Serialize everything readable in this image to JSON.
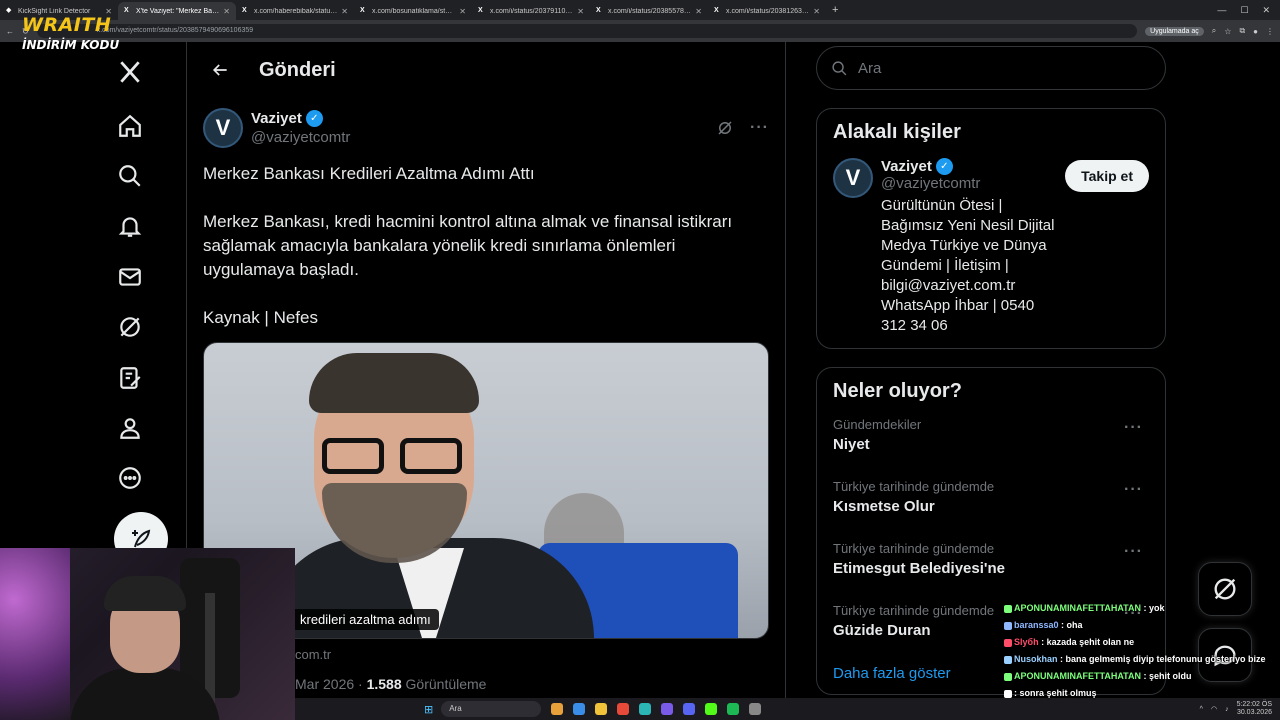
{
  "browser": {
    "tabs": [
      {
        "label": "KickSight Link Detector",
        "active": false
      },
      {
        "label": "X'te Vaziyet: \"Merkez Bankası K",
        "active": true
      },
      {
        "label": "x.com/haberebibak/status/2038",
        "active": false
      },
      {
        "label": "x.com/bosunatiklama/status/20",
        "active": false
      },
      {
        "label": "x.com/i/status/20379110795",
        "active": false
      },
      {
        "label": "x.com/i/status/203855786352",
        "active": false
      },
      {
        "label": "x.com/i/status/20381263057",
        "active": false
      }
    ],
    "url": "x.com/vaziyetcomtr/status/2038579490696106359",
    "app_chip": "Uygulamada aç"
  },
  "overlay_brand": {
    "main": "WRAITH",
    "sub": "İNDİRİM KODU"
  },
  "header": {
    "title": "Gönderi"
  },
  "post": {
    "author_name": "Vaziyet",
    "author_handle": "@vaziyetcomtr",
    "title": "Merkez Bankası Kredileri Azaltma Adımı Attı",
    "body": "Merkez Bankası, kredi hacmini kontrol altına almak ve finansal istikrarı sağlamak amacıyla bankalara yönelik kredi sınırlama önlemleri uygulamaya başladı.",
    "source": "Kaynak | Nefes",
    "media_caption": "kredileri azaltma adımı",
    "link_domain": "com.tr",
    "meta_date": "Mar 2026 · ",
    "meta_views": "1.588",
    "meta_views_label": " Görüntüleme"
  },
  "search": {
    "placeholder": "Ara"
  },
  "related": {
    "title": "Alakalı kişiler",
    "name": "Vaziyet",
    "handle": "@vaziyetcomtr",
    "follow_label": "Takip et",
    "bio": "Gürültünün Ötesi | Bağımsız Yeni Nesil Dijital Medya Türkiye ve Dünya Gündemi | İletişim | bilgi@vaziyet.com.tr WhatsApp İhbar | 0540 312 34 06"
  },
  "trends": {
    "title": "Neler oluyor?",
    "items": [
      {
        "context": "Gündemdekiler",
        "name": "Niyet"
      },
      {
        "context": "Türkiye tarihinde gündemde",
        "name": "Kısmetse Olur"
      },
      {
        "context": "Türkiye tarihinde gündemde",
        "name": "Etimesgut Belediyesi'ne"
      },
      {
        "context": "Türkiye tarihinde gündemde",
        "name": "Güzide Duran"
      }
    ],
    "show_more": "Daha fazla göster"
  },
  "chat": [
    {
      "user": "APONUNAMINAFETTAHATAN",
      "text": " : yok",
      "color": "#7dff7d"
    },
    {
      "user": "baranssa0",
      "text": " : oha",
      "color": "#8fb8ff"
    },
    {
      "user": "Slyбh",
      "text": " : kazada şehit olan ne",
      "color": "#ff4d6a"
    },
    {
      "user": "Nusokhan",
      "text": " : bana gelmemiş diyip telefonunu gösteriyo bize",
      "color": "#9ad0ff"
    },
    {
      "user": "APONUNAMINAFETTAHATAN",
      "text": " : şehit oldu",
      "color": "#7dff7d"
    },
    {
      "user": "",
      "text": ": sonra şehit olmuş",
      "color": "#ffffff"
    }
  ],
  "taskbar": {
    "search_label": "Ara",
    "time": "5:22:02 ÖS",
    "date": "30.03.2026"
  }
}
